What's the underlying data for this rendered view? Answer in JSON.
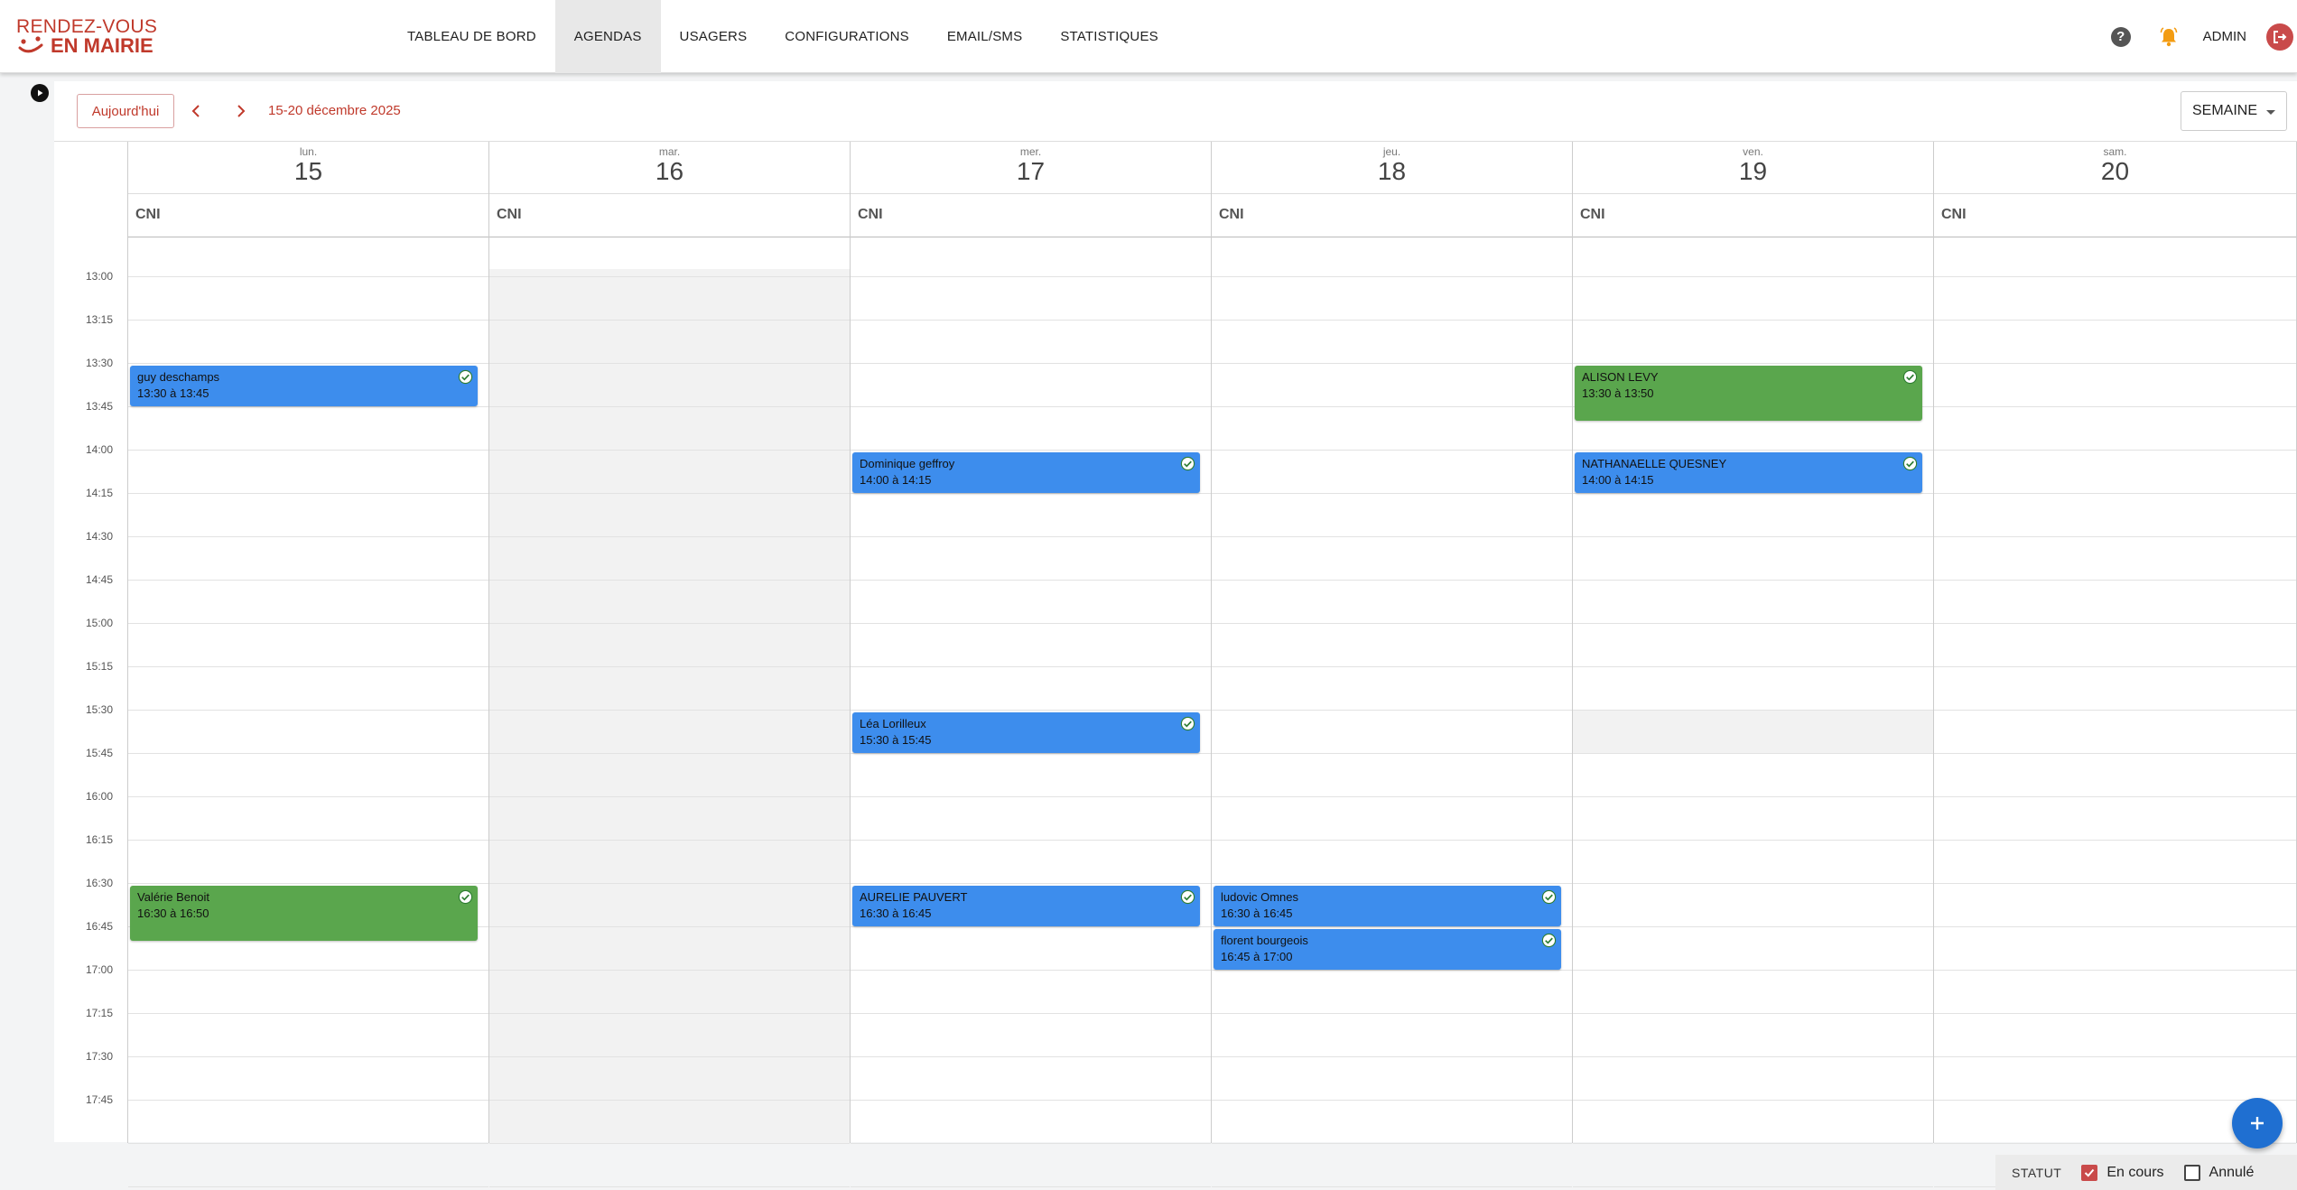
{
  "logo": {
    "line1": "RENDEZ-VOUS",
    "line2": "EN MAIRIE",
    "color": "#c0392b"
  },
  "nav": {
    "items": [
      {
        "label": "TABLEAU DE BORD",
        "active": false
      },
      {
        "label": "AGENDAS",
        "active": true
      },
      {
        "label": "USAGERS",
        "active": false
      },
      {
        "label": "CONFIGURATIONS",
        "active": false
      },
      {
        "label": "EMAIL/SMS",
        "active": false
      },
      {
        "label": "STATISTIQUES",
        "active": false
      }
    ],
    "help_icon": "help-icon",
    "bell_icon": "bell-icon",
    "user_label": "ADMIN",
    "logout_icon": "logout-icon"
  },
  "toolbar": {
    "today_label": "Aujourd'hui",
    "prev_icon": "chevron-left-icon",
    "next_icon": "chevron-right-icon",
    "date_range": "15-20 décembre 2025",
    "view_label": "SEMAINE"
  },
  "calendar": {
    "days": [
      {
        "name": "lun.",
        "num": "15",
        "resource": "CNI"
      },
      {
        "name": "mar.",
        "num": "16",
        "resource": "CNI"
      },
      {
        "name": "mer.",
        "num": "17",
        "resource": "CNI"
      },
      {
        "name": "jeu.",
        "num": "18",
        "resource": "CNI"
      },
      {
        "name": "ven.",
        "num": "19",
        "resource": "CNI"
      },
      {
        "name": "sam.",
        "num": "20",
        "resource": "CNI"
      }
    ],
    "time_slots": [
      "13:00",
      "13:15",
      "13:30",
      "13:45",
      "14:00",
      "14:15",
      "14:30",
      "14:45",
      "15:00",
      "15:15",
      "15:30",
      "15:45",
      "16:00",
      "16:15",
      "16:30",
      "16:45",
      "17:00",
      "17:15",
      "17:30",
      "17:45"
    ],
    "events": [
      {
        "day": 0,
        "title": "guy deschamps",
        "time": "13:30 à 13:45",
        "color": "blue"
      },
      {
        "day": 0,
        "title": "Valérie Benoit",
        "time": "16:30 à 16:50",
        "color": "green"
      },
      {
        "day": 2,
        "title": "Dominique geffroy",
        "time": "14:00 à 14:15",
        "color": "blue"
      },
      {
        "day": 2,
        "title": "Léa  Lorilleux",
        "time": "15:30 à 15:45",
        "color": "blue"
      },
      {
        "day": 2,
        "title": "AURELIE PAUVERT",
        "time": "16:30 à 16:45",
        "color": "blue"
      },
      {
        "day": 3,
        "title": "ludovic Omnes",
        "time": "16:30 à 16:45",
        "color": "blue"
      },
      {
        "day": 3,
        "title": "florent bourgeois",
        "time": "16:45 à 17:00",
        "color": "blue"
      },
      {
        "day": 4,
        "title": "ALISON LEVY",
        "time": "13:30 à 13:50",
        "color": "green"
      },
      {
        "day": 4,
        "title": "NATHANAELLE QUESNEY",
        "time": "14:00 à 14:15",
        "color": "blue"
      }
    ],
    "event_colors": {
      "blue": "#3d8ded",
      "green": "#5aa64d"
    },
    "check_icon": "check-circle-icon"
  },
  "footer": {
    "fab_icon": "plus-icon",
    "status_label": "STATUT",
    "filters": [
      {
        "label": "En cours",
        "checked": true
      },
      {
        "label": "Annulé",
        "checked": false
      }
    ]
  }
}
